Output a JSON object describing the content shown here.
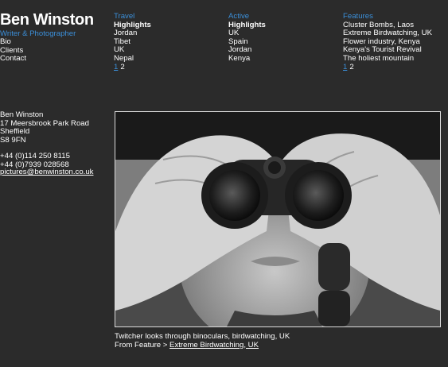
{
  "site": {
    "title": "Ben Winston",
    "tagline": "Writer & Photographer"
  },
  "left_nav": [
    "Bio",
    "Clients",
    "Contact"
  ],
  "columns": [
    {
      "heading": "Travel",
      "section_label": "Highlights",
      "items": [
        "Jordan",
        "Tibet",
        "UK",
        "Nepal"
      ],
      "pages": [
        "1",
        "2"
      ],
      "current_page": "1"
    },
    {
      "heading": "Active",
      "section_label": "Highlights",
      "items": [
        "UK",
        "Spain",
        "Jordan",
        "Kenya"
      ],
      "pages": [],
      "current_page": ""
    },
    {
      "heading": "Features",
      "section_label": "",
      "items": [
        "Cluster Bombs, Laos",
        "Extreme Birdwatching, UK",
        "Flower industry, Kenya",
        "Kenya's Tourist Revival",
        "The holiest mountain"
      ],
      "pages": [
        "1",
        "2"
      ],
      "current_page": "1"
    }
  ],
  "contact": {
    "name": "Ben Winston",
    "street": "17 Meersbrook Park Road",
    "city": "Sheffield",
    "postcode": "S8 9FN",
    "phone": "+44 (0)114 250 8115",
    "mobile": "+44 (0)7939 028568",
    "email": "pictures@benwinston.co.uk"
  },
  "photo": {
    "caption": "Twitcher looks through binoculars, birdwatching, UK",
    "from_prefix": "From Feature > ",
    "feature_link": "Extreme Birdwatching, UK"
  },
  "colors": {
    "background": "#2b2b2b",
    "accent": "#3b8fd9",
    "text": "#ffffff"
  }
}
